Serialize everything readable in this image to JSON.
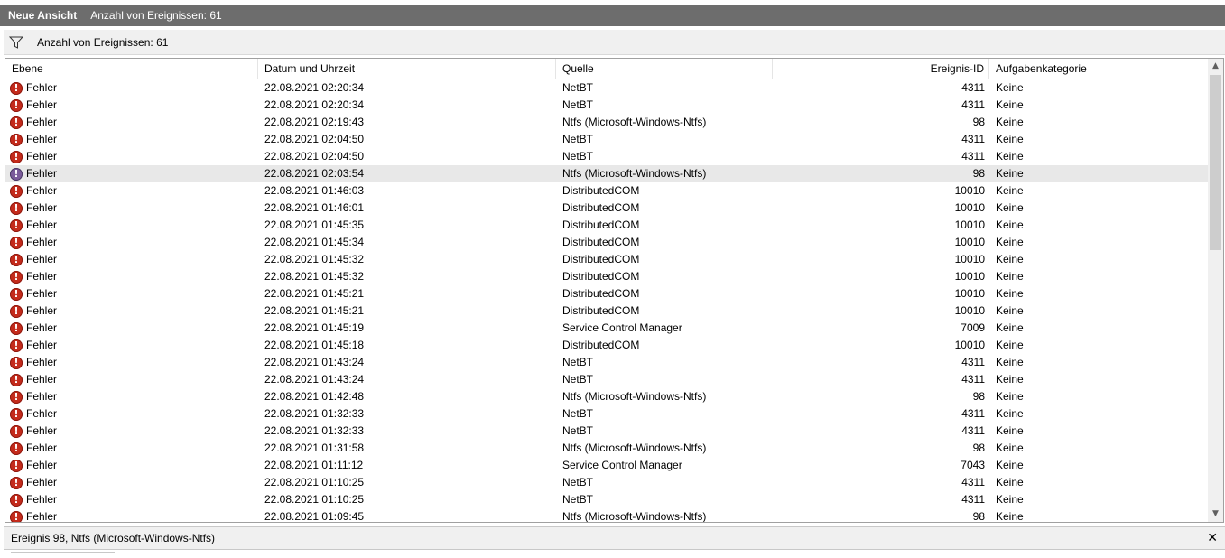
{
  "titlebar": {
    "title": "Neue Ansicht",
    "count": "Anzahl von Ereignissen: 61"
  },
  "filterbar": {
    "icon": "filter-icon",
    "text": "Anzahl von Ereignissen: 61"
  },
  "columns": {
    "level": "Ebene",
    "date": "Datum und Uhrzeit",
    "source": "Quelle",
    "extra": "",
    "id": "Ereignis-ID",
    "category": "Aufgabenkategorie"
  },
  "rows": [
    {
      "level": "Fehler",
      "date": "22.08.2021 02:20:34",
      "source": "NetBT",
      "id": "4311",
      "category": "Keine"
    },
    {
      "level": "Fehler",
      "date": "22.08.2021 02:20:34",
      "source": "NetBT",
      "id": "4311",
      "category": "Keine"
    },
    {
      "level": "Fehler",
      "date": "22.08.2021 02:19:43",
      "source": "Ntfs (Microsoft-Windows-Ntfs)",
      "id": "98",
      "category": "Keine"
    },
    {
      "level": "Fehler",
      "date": "22.08.2021 02:04:50",
      "source": "NetBT",
      "id": "4311",
      "category": "Keine"
    },
    {
      "level": "Fehler",
      "date": "22.08.2021 02:04:50",
      "source": "NetBT",
      "id": "4311",
      "category": "Keine"
    },
    {
      "level": "Fehler",
      "date": "22.08.2021 02:03:54",
      "source": "Ntfs (Microsoft-Windows-Ntfs)",
      "id": "98",
      "category": "Keine",
      "selected": true
    },
    {
      "level": "Fehler",
      "date": "22.08.2021 01:46:03",
      "source": "DistributedCOM",
      "id": "10010",
      "category": "Keine"
    },
    {
      "level": "Fehler",
      "date": "22.08.2021 01:46:01",
      "source": "DistributedCOM",
      "id": "10010",
      "category": "Keine"
    },
    {
      "level": "Fehler",
      "date": "22.08.2021 01:45:35",
      "source": "DistributedCOM",
      "id": "10010",
      "category": "Keine"
    },
    {
      "level": "Fehler",
      "date": "22.08.2021 01:45:34",
      "source": "DistributedCOM",
      "id": "10010",
      "category": "Keine"
    },
    {
      "level": "Fehler",
      "date": "22.08.2021 01:45:32",
      "source": "DistributedCOM",
      "id": "10010",
      "category": "Keine"
    },
    {
      "level": "Fehler",
      "date": "22.08.2021 01:45:32",
      "source": "DistributedCOM",
      "id": "10010",
      "category": "Keine"
    },
    {
      "level": "Fehler",
      "date": "22.08.2021 01:45:21",
      "source": "DistributedCOM",
      "id": "10010",
      "category": "Keine"
    },
    {
      "level": "Fehler",
      "date": "22.08.2021 01:45:21",
      "source": "DistributedCOM",
      "id": "10010",
      "category": "Keine"
    },
    {
      "level": "Fehler",
      "date": "22.08.2021 01:45:19",
      "source": "Service Control Manager",
      "id": "7009",
      "category": "Keine"
    },
    {
      "level": "Fehler",
      "date": "22.08.2021 01:45:18",
      "source": "DistributedCOM",
      "id": "10010",
      "category": "Keine"
    },
    {
      "level": "Fehler",
      "date": "22.08.2021 01:43:24",
      "source": "NetBT",
      "id": "4311",
      "category": "Keine"
    },
    {
      "level": "Fehler",
      "date": "22.08.2021 01:43:24",
      "source": "NetBT",
      "id": "4311",
      "category": "Keine"
    },
    {
      "level": "Fehler",
      "date": "22.08.2021 01:42:48",
      "source": "Ntfs (Microsoft-Windows-Ntfs)",
      "id": "98",
      "category": "Keine"
    },
    {
      "level": "Fehler",
      "date": "22.08.2021 01:32:33",
      "source": "NetBT",
      "id": "4311",
      "category": "Keine"
    },
    {
      "level": "Fehler",
      "date": "22.08.2021 01:32:33",
      "source": "NetBT",
      "id": "4311",
      "category": "Keine"
    },
    {
      "level": "Fehler",
      "date": "22.08.2021 01:31:58",
      "source": "Ntfs (Microsoft-Windows-Ntfs)",
      "id": "98",
      "category": "Keine"
    },
    {
      "level": "Fehler",
      "date": "22.08.2021 01:11:12",
      "source": "Service Control Manager",
      "id": "7043",
      "category": "Keine"
    },
    {
      "level": "Fehler",
      "date": "22.08.2021 01:10:25",
      "source": "NetBT",
      "id": "4311",
      "category": "Keine"
    },
    {
      "level": "Fehler",
      "date": "22.08.2021 01:10:25",
      "source": "NetBT",
      "id": "4311",
      "category": "Keine"
    },
    {
      "level": "Fehler",
      "date": "22.08.2021 01:09:45",
      "source": "Ntfs (Microsoft-Windows-Ntfs)",
      "id": "98",
      "category": "Keine"
    }
  ],
  "detail": {
    "title": "Ereignis 98, Ntfs (Microsoft-Windows-Ntfs)",
    "close_label": "✕"
  },
  "colors": {
    "error_icon": "#c42b1c",
    "titlebar_bg": "#6d6d6d",
    "selected_row": "#e8e8e8"
  }
}
